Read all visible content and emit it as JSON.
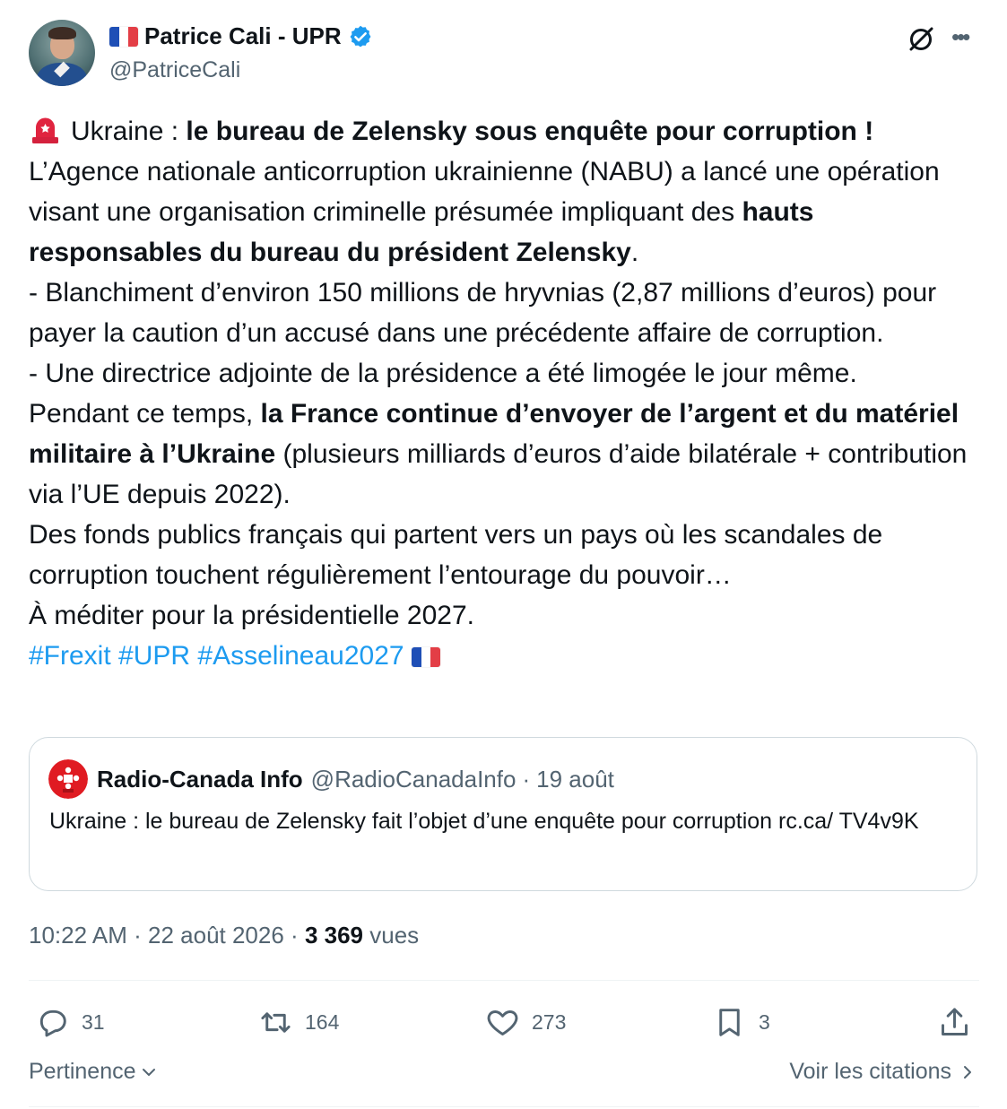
{
  "author": {
    "name": "Patrice Cali - UPR",
    "handle": "@PatriceCali",
    "flag_icon": "french-flag-icon",
    "verified_icon": "verified-badge-icon"
  },
  "tweet": {
    "line1_prefix": "Ukraine : ",
    "line1_bold": "le bureau de Zelensky sous enquête pour corruption !",
    "para2_a": "L’Agence nationale anticorruption ukrainienne (NABU) a lancé une opération visant une organisation criminelle présumée impliquant des ",
    "para2_bold": "hauts responsables du bureau du président Zelensky",
    "para2_b": ".",
    "para3": "- Blanchiment d’environ 150 millions de hryvnias (2,87 millions d’euros) pour payer la caution d’un accusé dans une précédente affaire de corruption.",
    "para4": "- Une directrice adjointe de la présidence a été limogée le jour même.",
    "para5_a": "Pendant ce temps, ",
    "para5_bold": "la France continue d’envoyer de l’argent et du matériel militaire à l’Ukraine",
    "para5_b": " (plusieurs milliards d’euros d’aide bilatérale + contribution via l’UE depuis 2022).",
    "para6": "Des fonds publics français qui partent vers un pays où les scandales de corruption touchent régulièrement l’entourage du pouvoir…",
    "para7": "À méditer pour la présidentielle 2027.",
    "hashtags": "#Frexit #UPR #Asselineau2027"
  },
  "quote": {
    "name": "Radio-Canada Info",
    "handle": "@RadioCanadaInfo",
    "separator": "·",
    "date": "19 août",
    "text": "Ukraine : le bureau de Zelensky fait l’objet d’une enquête pour corruption rc.ca/ TV4v9K"
  },
  "meta": {
    "time": "10:22 AM",
    "separator1": "·",
    "date": "22 août 2026",
    "separator2": "·",
    "views_count": "3 369",
    "views_label": "vues"
  },
  "actions": {
    "replies": "31",
    "reposts": "164",
    "likes": "273",
    "bookmarks": "3"
  },
  "footer": {
    "sort_label": "Pertinence",
    "citations_label": "Voir les citations"
  },
  "colors": {
    "text": "#0f1419",
    "secondary": "#536471",
    "link": "#1d9bf0",
    "border": "#cfd9de",
    "divider": "#eff3f4"
  }
}
